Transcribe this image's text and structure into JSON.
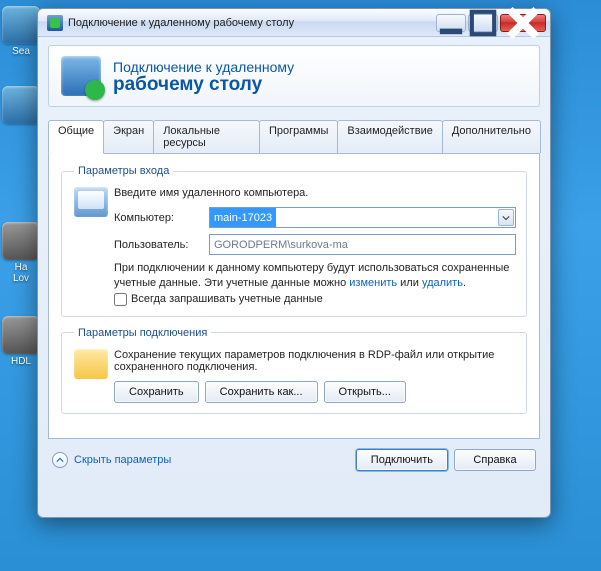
{
  "window": {
    "title": "Подключение к удаленному рабочему столу"
  },
  "banner": {
    "line1": "Подключение к удаленному",
    "line2": "рабочему столу"
  },
  "tabs": [
    "Общие",
    "Экран",
    "Локальные ресурсы",
    "Программы",
    "Взаимодействие",
    "Дополнительно"
  ],
  "login": {
    "legend": "Параметры входа",
    "prompt": "Введите имя удаленного компьютера.",
    "computer_label": "Компьютер:",
    "computer_value": "main-17023",
    "user_label": "Пользователь:",
    "user_value": "GORODPERM\\surkova-ma",
    "note_pre": "При подключении к данному компьютеру будут использоваться сохраненные учетные данные. Эти учетные данные можно ",
    "note_link1": "изменить",
    "note_mid": " или ",
    "note_link2": "удалить",
    "note_post": ".",
    "checkbox_label": "Всегда запрашивать учетные данные"
  },
  "conn": {
    "legend": "Параметры подключения",
    "desc": "Сохранение текущих параметров подключения в RDP-файл или открытие сохраненного подключения.",
    "save": "Сохранить",
    "save_as": "Сохранить как...",
    "open": "Открыть..."
  },
  "footer": {
    "hide": "Скрыть параметры",
    "connect": "Подключить",
    "help": "Справка"
  },
  "desktop": {
    "d1": "Sea",
    "d2": "",
    "d3": "Ha",
    "d4": "Lov",
    "d5": "HDL"
  }
}
